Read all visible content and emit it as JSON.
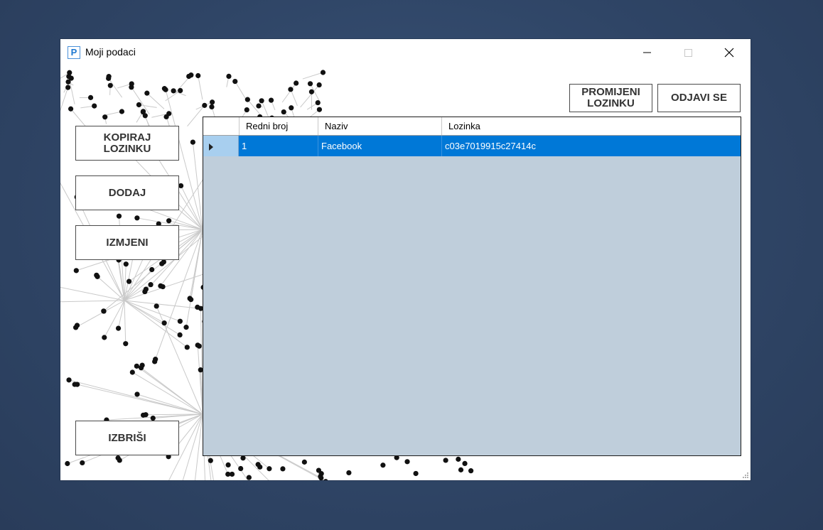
{
  "window": {
    "title": "Moji podaci",
    "icon_letter": "P",
    "controls": {
      "minimize_icon": "minimize-icon",
      "maximize_icon": "maximize-icon",
      "close_icon": "close-icon"
    }
  },
  "buttons": {
    "change_password_line1": "PROMIJENI",
    "change_password_line2": "LOZINKU",
    "logout": "ODJAVI SE",
    "copy_password_line1": "KOPIRAJ",
    "copy_password_line2": "LOZINKU",
    "add": "DODAJ",
    "edit": "IZMJENI",
    "delete": "IZBRIŠI"
  },
  "grid": {
    "columns": [
      "Redni broj",
      "Naziv",
      "Lozinka"
    ],
    "rows": [
      {
        "redni_broj": "1",
        "naziv": "Facebook",
        "lozinka": "c03e7019915c27414c",
        "selected": true
      }
    ],
    "colors": {
      "background": "#bfcedb",
      "selection": "#0078d7",
      "row_header_selected": "#a8cfef"
    }
  },
  "colors": {
    "desktop": "#2f4566",
    "window": "#ffffff"
  }
}
